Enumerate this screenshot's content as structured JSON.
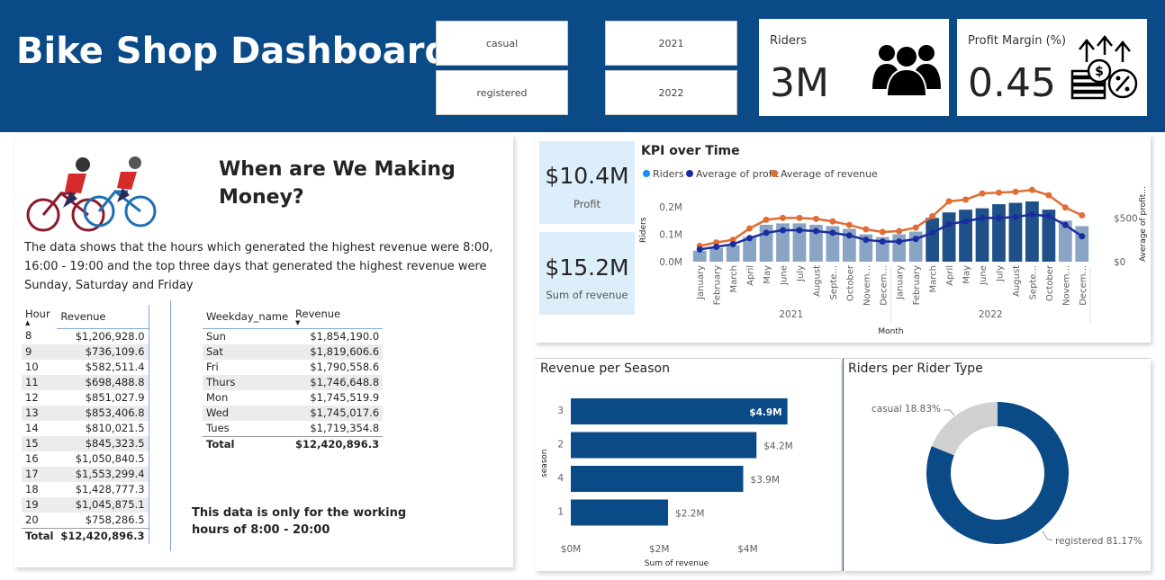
{
  "header": {
    "title": "Bike Shop Dashboard"
  },
  "slicers": {
    "rider_type": [
      "casual",
      "registered"
    ],
    "year": [
      "2021",
      "2022"
    ]
  },
  "kpis": {
    "riders": {
      "label": "Riders",
      "value": "3M",
      "icon": "people-group-icon"
    },
    "profit_margin": {
      "label": "Profit Margin (%)",
      "value": "0.45",
      "icon": "money-growth-icon"
    }
  },
  "money_panel": {
    "heading": "When are We Making Money?",
    "description": "The data shows that the hours which generated the highest revenue were 8:00, 16:00 - 19:00 and the top three days that generated the highest revenue were Sunday, Saturday and Friday",
    "note": "This data is only for the working hours of 8:00 - 20:00",
    "illustration": "cyclists-icon",
    "hour_table": {
      "headers": [
        "Hour",
        "Revenue"
      ],
      "rows": [
        [
          "8",
          "$1,206,928.0"
        ],
        [
          "9",
          "$736,109.6"
        ],
        [
          "10",
          "$582,511.4"
        ],
        [
          "11",
          "$698,488.8"
        ],
        [
          "12",
          "$851,027.9"
        ],
        [
          "13",
          "$853,406.8"
        ],
        [
          "14",
          "$810,021.5"
        ],
        [
          "15",
          "$845,323.5"
        ],
        [
          "16",
          "$1,050,840.5"
        ],
        [
          "17",
          "$1,553,299.4"
        ],
        [
          "18",
          "$1,428,777.3"
        ],
        [
          "19",
          "$1,045,875.1"
        ],
        [
          "20",
          "$758,286.5"
        ]
      ],
      "total": [
        "Total",
        "$12,420,896.3"
      ]
    },
    "weekday_table": {
      "headers": [
        "Weekday_name",
        "Revenue"
      ],
      "rows": [
        [
          "Sun",
          "$1,854,190.0"
        ],
        [
          "Sat",
          "$1,819,606.6"
        ],
        [
          "Fri",
          "$1,790,558.6"
        ],
        [
          "Thurs",
          "$1,746,648.8"
        ],
        [
          "Mon",
          "$1,745,519.9"
        ],
        [
          "Wed",
          "$1,745,017.6"
        ],
        [
          "Tues",
          "$1,719,354.8"
        ]
      ],
      "total": [
        "Total",
        "$12,420,896.3"
      ]
    }
  },
  "kpi_over_time": {
    "cards": [
      {
        "value": "$10.4M",
        "label": "Profit"
      },
      {
        "value": "$15.2M",
        "label": "Sum of revenue"
      }
    ]
  },
  "colors": {
    "banner": "#0a4a86",
    "bar_light": "#8aa5c4",
    "bar_dark": "#1f5188",
    "profit_line": "#1b2d9e",
    "revenue_line": "#e06d34",
    "riders_legend": "#118dff",
    "donut_registered": "#0a4a86",
    "donut_casual": "#d0d0d0"
  },
  "chart_data": [
    {
      "type": "bar",
      "title": "KPI over Time",
      "xlabel": "Month",
      "ylabel": "Riders",
      "y2label": "Average of profit...",
      "legend": [
        "Riders",
        "Average of profit",
        "Average of revenue"
      ],
      "legend_position": "top-left",
      "categories": [
        "January",
        "February",
        "March",
        "April",
        "May",
        "June",
        "July",
        "August",
        "Septe...",
        "October",
        "Novem...",
        "Decem...",
        "January",
        "February",
        "March",
        "April",
        "May",
        "June",
        "July",
        "August",
        "Septe...",
        "October",
        "Novem...",
        "Decem..."
      ],
      "year_groups": [
        {
          "label": "2021",
          "span": 12
        },
        {
          "label": "2022",
          "span": 12
        }
      ],
      "ylim": [
        0,
        0.23
      ],
      "yticks": [
        "0.0M",
        "0.1M",
        "0.2M"
      ],
      "y2lim": [
        0,
        720
      ],
      "y2ticks": [
        "$0",
        "$500"
      ],
      "series": [
        {
          "name": "Riders",
          "kind": "bar",
          "values": [
            0.04,
            0.05,
            0.06,
            0.09,
            0.135,
            0.14,
            0.14,
            0.135,
            0.13,
            0.12,
            0.1,
            0.09,
            0.1,
            0.11,
            0.16,
            0.18,
            0.19,
            0.195,
            0.21,
            0.215,
            0.22,
            0.19,
            0.15,
            0.13
          ]
        },
        {
          "name": "Average of profit",
          "kind": "line",
          "values": [
            140,
            170,
            200,
            270,
            330,
            360,
            360,
            350,
            330,
            300,
            250,
            230,
            230,
            260,
            330,
            430,
            460,
            500,
            500,
            510,
            540,
            520,
            420,
            290
          ]
        },
        {
          "name": "Average of revenue",
          "kind": "line",
          "values": [
            180,
            220,
            250,
            380,
            480,
            500,
            500,
            490,
            460,
            420,
            370,
            340,
            350,
            390,
            520,
            690,
            710,
            780,
            790,
            800,
            820,
            760,
            620,
            530
          ]
        }
      ]
    },
    {
      "type": "bar",
      "orientation": "horizontal",
      "title": "Revenue per Season",
      "xlabel": "Sum of revenue",
      "ylabel": "season",
      "categories": [
        "3",
        "2",
        "4",
        "1"
      ],
      "values": [
        4.9,
        4.2,
        3.9,
        2.2
      ],
      "labels": [
        "$4.9M",
        "$4.2M",
        "$3.9M",
        "$2.2M"
      ],
      "xticks": [
        "$0M",
        "$2M",
        "$4M"
      ],
      "xlim": [
        0,
        5.6
      ]
    },
    {
      "type": "pie",
      "donut": true,
      "title": "Riders per Rider Type",
      "slices": [
        {
          "name": "registered",
          "value": 81.17,
          "label": "registered 81.17%"
        },
        {
          "name": "casual",
          "value": 18.83,
          "label": "casual 18.83%"
        }
      ]
    }
  ]
}
